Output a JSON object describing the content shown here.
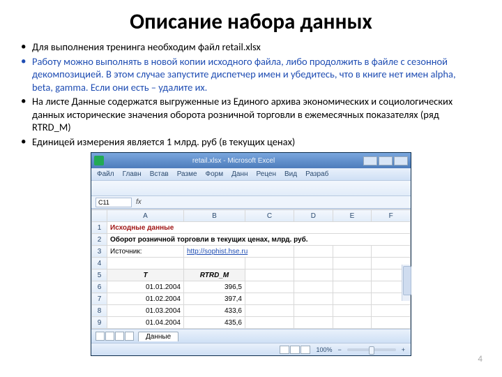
{
  "slide": {
    "title": "Описание набора данных",
    "page_number": "4",
    "bullets": [
      "Для выполнения тренинга необходим файл retail.xlsx",
      "Работу можно выполнять в новой копии исходного файла, либо продолжить в файле с сезонной декомпозицией. В этом случае запустите диспетчер имен и убедитесь, что в книге нет имен alpha, beta, gamma. Если они есть – удалите их.",
      "На листе Данные содержатся выгруженные из Единого архива экономических и социологических данных  исторические значения оборота розничной торговли в ежемесячных  показателях (ряд RTRD_M)",
      "Единицей измерения является 1 млрд. руб (в текущих ценах)"
    ]
  },
  "excel": {
    "window_title": "retail.xlsx - Microsoft Excel",
    "menu": [
      "Файл",
      "Главн",
      "Встав",
      "Разме",
      "Форм",
      "Данн",
      "Рецен",
      "Вид",
      "Разраб"
    ],
    "name_box": "C11",
    "columns": [
      "A",
      "B",
      "C",
      "D",
      "E",
      "F"
    ],
    "r1_heading": "Исходные данные",
    "r2_text": "Оборот розничной торговли в текущих ценах, млрд. руб.",
    "r3_label": "Источник:",
    "r3_link": "http://sophist.hse.ru",
    "data_headers": {
      "t": "T",
      "series": "RTRD_M"
    },
    "rows": [
      {
        "n": "6",
        "t": "01.01.2004",
        "v": "396,5"
      },
      {
        "n": "7",
        "t": "01.02.2004",
        "v": "397,4"
      },
      {
        "n": "8",
        "t": "01.03.2004",
        "v": "433,6"
      },
      {
        "n": "9",
        "t": "01.04.2004",
        "v": "435,6"
      }
    ],
    "sheet_tab": "Данные",
    "zoom": "100%"
  }
}
